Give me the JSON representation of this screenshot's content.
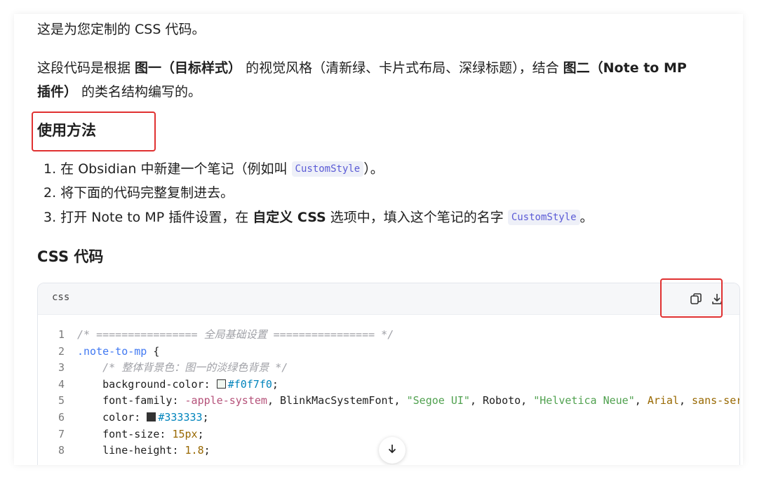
{
  "intro": "这是为您定制的 CSS 代码。",
  "desc": {
    "part1": "这段代码是根据 ",
    "bold1": "图一（目标样式）",
    "part2": " 的视觉风格（清新绿、卡片式布局、深绿标题），结合 ",
    "bold2": "图二（Note to MP",
    "bold3": "插件）",
    "part3": " 的类名结构编写的。"
  },
  "usage": {
    "heading": "使用方法",
    "step1_prefix": "1. 在 Obsidian 中新建一个笔记（例如叫 ",
    "step1_code": "CustomStyle",
    "step1_suffix": "）。",
    "step2": "2. 将下面的代码完整复制进去。",
    "step3_prefix": "3. 打开 Note to MP 插件设置，在 ",
    "step3_bold": "自定义 CSS",
    "step3_mid": " 选项中，填入这个笔记的名字 ",
    "step3_code": "CustomStyle",
    "step3_suffix": "。"
  },
  "css_heading": "CSS 代码",
  "code_block": {
    "lang": "css",
    "copy_icon": "copy-icon",
    "download_icon": "download-icon",
    "line_numbers": [
      "1",
      "2",
      "3",
      "4",
      "5",
      "6",
      "7",
      "8"
    ],
    "l1": "/* ================ 全局基础设置 ================ */",
    "l2_sel": ".note-to-mp",
    "l2_brace": " {",
    "l3": "    /* 整体背景色：图一的淡绿色背景 */",
    "l4_prop": "    background-color: ",
    "l4_val": "#f0f7f0",
    "l4_end": ";",
    "l5_prop": "    font-family: ",
    "l5_a": "-apple-system",
    "l5_b": ", BlinkMacSystemFont, ",
    "l5_c": "\"Segoe UI\"",
    "l5_d": ", Roboto, ",
    "l5_e": "\"Helvetica Neue\"",
    "l5_f": ", ",
    "l5_g": "Arial",
    "l5_h": ", ",
    "l5_i": "sans-serif",
    "l6_prop": "    color: ",
    "l6_val": "#333333",
    "l6_end": ";",
    "l7_prop": "    font-size: ",
    "l7_val": "15px",
    "l7_end": ";",
    "l8_prop": "    line-height: ",
    "l8_val": "1.8",
    "l8_end": ";"
  },
  "colors": {
    "swatch1": "#f0f7f0",
    "swatch2": "#333333",
    "highlight": "#e03131"
  },
  "scroll_icon": "arrow-down-icon"
}
